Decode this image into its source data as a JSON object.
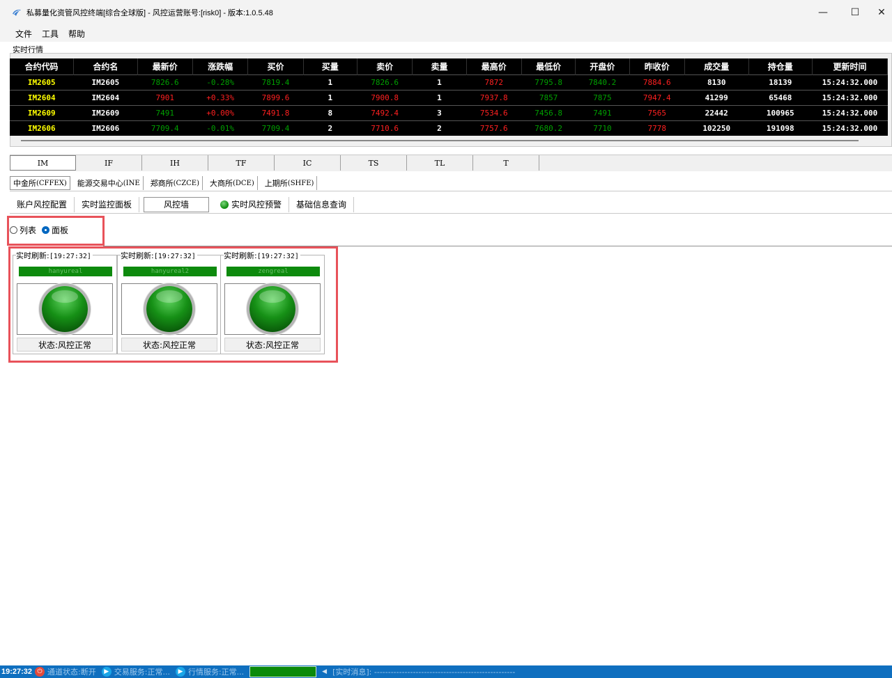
{
  "window": {
    "title": "私募量化资管风控终端[综合全球版] - 风控运营账号:[risk0] - 版本:1.0.5.48",
    "minimize_glyph": "—",
    "maximize_glyph": "☐",
    "close_glyph": "✕"
  },
  "menu": [
    "文件",
    "工具",
    "帮助"
  ],
  "market": {
    "label": "实时行情",
    "headers": [
      "合约代码",
      "合约名",
      "最新价",
      "涨跌幅",
      "买价",
      "买量",
      "卖价",
      "卖量",
      "最高价",
      "最低价",
      "开盘价",
      "昨收价",
      "成交量",
      "持仓量",
      "更新时间"
    ],
    "column_colors": [
      "code",
      "white",
      "green",
      "red",
      "green",
      "white",
      "green",
      "white",
      "red",
      "green",
      "green",
      "red",
      "white",
      "white",
      "white"
    ],
    "rows": [
      [
        "IM2605",
        "IM2605",
        "7826.6",
        "-0.28%",
        "7819.4",
        "1",
        "7826.6",
        "1",
        "7872",
        "7795.8",
        "7840.2",
        "7884.6",
        "8130",
        "18139",
        "15:24:32.000"
      ],
      [
        "IM2604",
        "IM2604",
        "7901",
        "+0.33%",
        "7899.6",
        "1",
        "7900.8",
        "1",
        "7937.8",
        "7857",
        "7875",
        "7947.4",
        "41299",
        "65468",
        "15:24:32.000"
      ],
      [
        "IM2609",
        "IM2609",
        "7491",
        "+0.00%",
        "7491.8",
        "8",
        "7492.4",
        "3",
        "7534.6",
        "7456.8",
        "7491",
        "7565",
        "22442",
        "100965",
        "15:24:32.000"
      ],
      [
        "IM2606",
        "IM2606",
        "7709.4",
        "-0.01%",
        "7709.4",
        "2",
        "7710.6",
        "2",
        "7757.6",
        "7680.2",
        "7710",
        "7778",
        "102250",
        "191098",
        "15:24:32.000"
      ]
    ],
    "row_colors": [
      [
        "code",
        "white",
        "green",
        "green",
        "green",
        "white",
        "green",
        "white",
        "red",
        "green",
        "green",
        "red",
        "white",
        "white",
        "white"
      ],
      [
        "code",
        "white",
        "red",
        "red",
        "red",
        "white",
        "red",
        "white",
        "red",
        "green",
        "green",
        "red",
        "white",
        "white",
        "white"
      ],
      [
        "code",
        "white",
        "green",
        "red",
        "red",
        "white",
        "red",
        "white",
        "red",
        "green",
        "green",
        "red",
        "white",
        "white",
        "white"
      ],
      [
        "code",
        "white",
        "green",
        "green",
        "green",
        "white",
        "red",
        "white",
        "red",
        "green",
        "green",
        "red",
        "white",
        "white",
        "white"
      ]
    ]
  },
  "product_tabs": [
    "IM",
    "IF",
    "IH",
    "TF",
    "IC",
    "TS",
    "TL",
    "T"
  ],
  "exchange_tabs": [
    {
      "cn": "中金所",
      "code": "(CFFEX)"
    },
    {
      "cn": "能源交易中心",
      "code": "(INE"
    },
    {
      "cn": "郑商所",
      "code": "(CZCE)"
    },
    {
      "cn": "大商所",
      "code": "(DCE)"
    },
    {
      "cn": "上期所",
      "code": "(SHFE)"
    }
  ],
  "function_tabs": [
    "账户风控配置",
    "实时监控面板",
    "风控墙",
    "实时风控预警",
    "基础信息查询"
  ],
  "view_mode": {
    "list": "列表",
    "panel": "面板"
  },
  "cards": [
    {
      "refresh_prefix": "实时刷新:",
      "time": "[19:27:32]",
      "account": "hanyureal",
      "status": "状态:风控正常"
    },
    {
      "refresh_prefix": "实时刷新:",
      "time": "[19:27:32]",
      "account": "hanyureal2",
      "status": "状态:风控正常"
    },
    {
      "refresh_prefix": "实时刷新:",
      "time": "[19:27:32]",
      "account": "zengreal",
      "status": "状态:风控正常"
    }
  ],
  "statusbar": {
    "time": "19:27:32",
    "channel": "通道状态:断开",
    "trade": "交易服务:正常...",
    "quote": "行情服务:正常...",
    "message": "[实时消息]: ---------------------------------------------------"
  }
}
